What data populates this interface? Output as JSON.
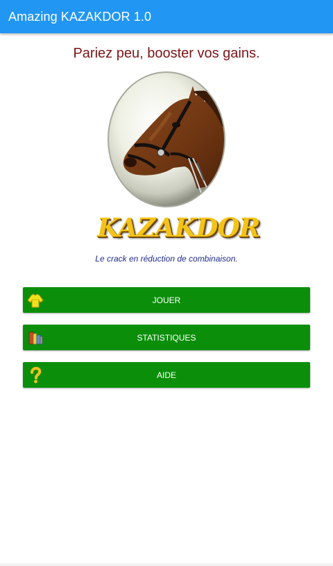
{
  "app_bar": {
    "title": "Amazing KAZAKDOR 1.0"
  },
  "main": {
    "slogan": "Pariez peu, booster vos gains.",
    "logo_text": "KAZAKDOR",
    "tagline": "Le crack en réduction de combinaison."
  },
  "menu": [
    {
      "label": "JOUER",
      "icon": "jockey-silks-icon"
    },
    {
      "label": "STATISTIQUES",
      "icon": "books-icon"
    },
    {
      "label": "AIDE",
      "icon": "question-mark-icon"
    }
  ],
  "colors": {
    "app_bar": "#2196f3",
    "button": "#0b8f0b",
    "slogan": "#7b1416",
    "tagline": "#1f2a8a",
    "logo": "#f3c418"
  }
}
